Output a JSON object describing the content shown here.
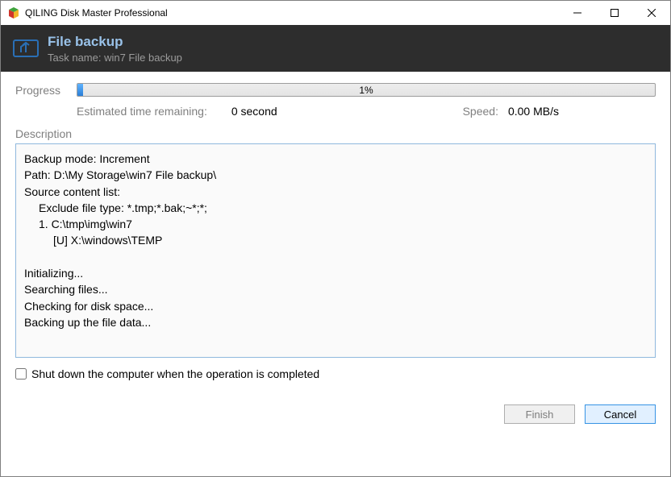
{
  "titlebar": {
    "title": "QILING Disk Master Professional"
  },
  "header": {
    "title": "File backup",
    "subtitle": "Task name: win7 File backup"
  },
  "progress": {
    "label": "Progress",
    "pct_text": "1%",
    "estimated_label": "Estimated time remaining:",
    "estimated_value": "0 second",
    "speed_label": "Speed:",
    "speed_value": "0.00 MB/s"
  },
  "description": {
    "label": "Description",
    "lines": {
      "l0": "Backup mode: Increment",
      "l1": "Path: D:\\My Storage\\win7 File backup\\",
      "l2": "Source content list:",
      "l3": "Exclude file type: *.tmp;*.bak;~*;*;",
      "l4": "1. C:\\tmp\\img\\win7",
      "l5": "[U] X:\\windows\\TEMP",
      "blank": " ",
      "l6": "Initializing...",
      "l7": "Searching files...",
      "l8": "Checking for disk space...",
      "l9": "Backing up the file data..."
    }
  },
  "checkbox": {
    "label": "Shut down the computer when the operation is completed"
  },
  "buttons": {
    "finish": "Finish",
    "cancel": "Cancel"
  }
}
